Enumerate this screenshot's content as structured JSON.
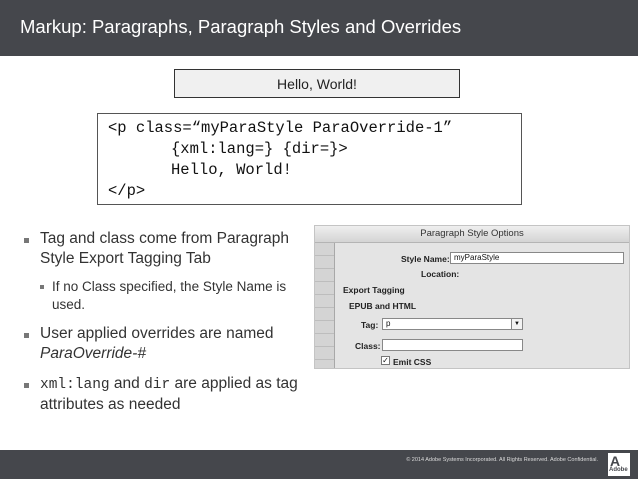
{
  "slide": {
    "title": "Markup: Paragraphs, Paragraph Styles and Overrides",
    "hello_box_text": "Hello, World!",
    "code_lines": [
      "<p class=“myParaStyle ParaOverride-1”",
      "{xml:lang=} {dir=}>",
      "Hello, World!",
      "</p>"
    ]
  },
  "bullets": [
    {
      "text": "Tag and class come from Paragraph Style Export Tagging Tab"
    },
    {
      "text": "If no Class specified, the Style Name is used."
    },
    {
      "text": "User applied overrides are named ",
      "italic": "ParaOverride-#"
    },
    {
      "code1": "xml:lang",
      "mid": " and ",
      "code2": "dir",
      "tail": " are applied as tag attributes as needed"
    }
  ],
  "dialog": {
    "title": "Paragraph Style Options",
    "style_name_label": "Style Name:",
    "style_name_value": "myParaStyle",
    "location_label": "Location:",
    "section_label": "Export Tagging",
    "group_label": "EPUB and HTML",
    "tag_label": "Tag:",
    "tag_value": "p",
    "dropdown_arrow": "▼",
    "class_label": "Class:",
    "class_value": "",
    "emit_css_label": "Emit CSS",
    "emit_css_checked": "✓"
  },
  "footer": {
    "copyright": "© 2014 Adobe Systems Incorporated. All Rights Reserved. Adobe Confidential.",
    "logo_glyph": "A",
    "logo_text": "Adobe"
  },
  "colors": {
    "header_bg": "#45474c",
    "footer_bg": "#45474c",
    "hello_box_bg": "#f0f0f0"
  }
}
